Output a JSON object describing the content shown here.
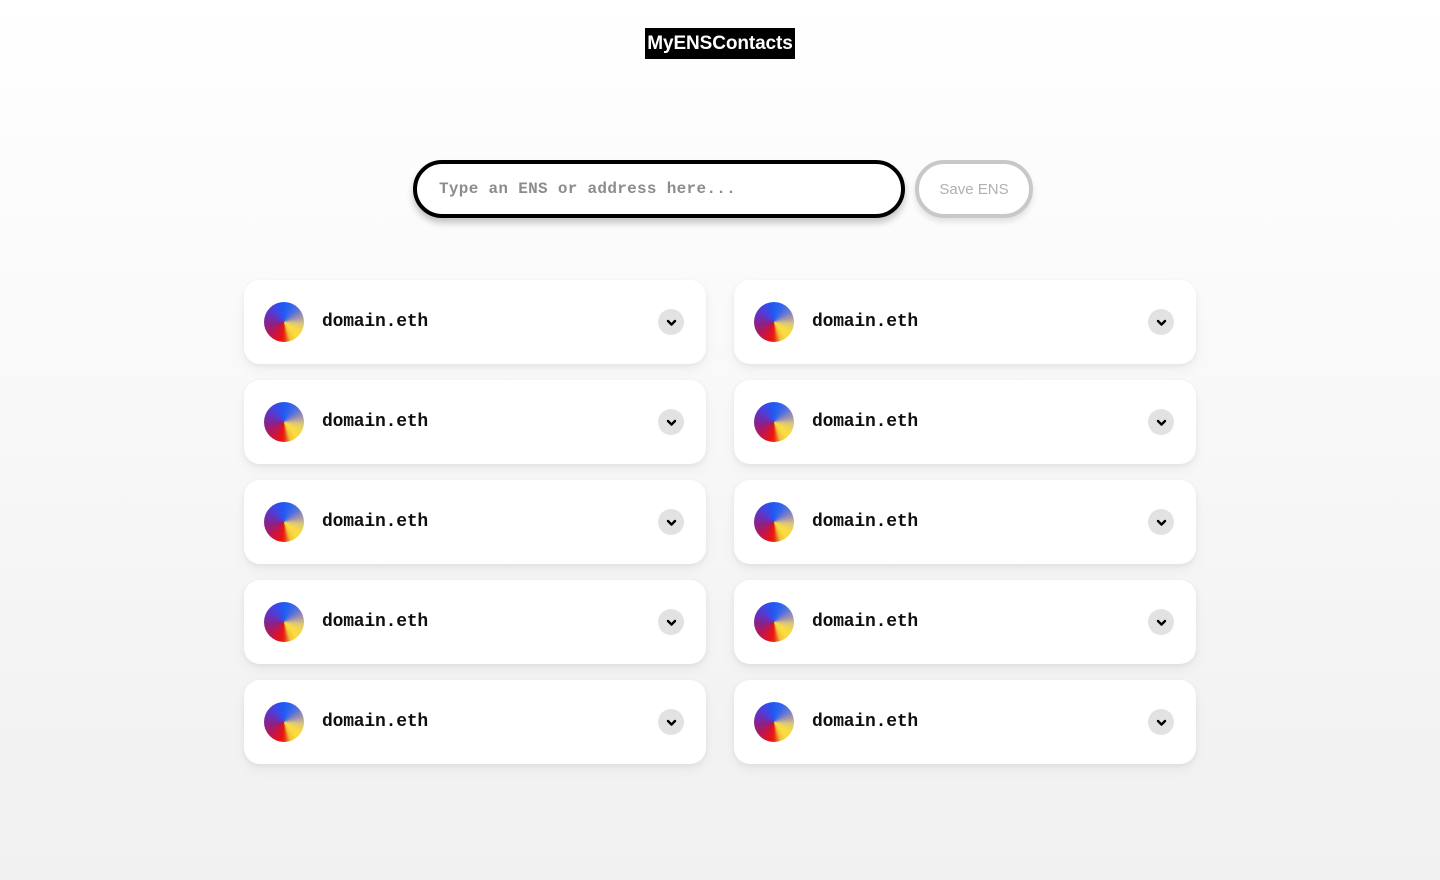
{
  "app": {
    "title": "MyENSContacts"
  },
  "search": {
    "placeholder": "Type an ENS or address here...",
    "value": "",
    "save_label": "Save ENS"
  },
  "contacts": {
    "columns": 2,
    "items": [
      {
        "name": "domain.eth",
        "avatar": "ens-gradient-avatar",
        "expand_icon": "chevron-down-icon"
      },
      {
        "name": "domain.eth",
        "avatar": "ens-gradient-avatar",
        "expand_icon": "chevron-down-icon"
      },
      {
        "name": "domain.eth",
        "avatar": "ens-gradient-avatar",
        "expand_icon": "chevron-down-icon"
      },
      {
        "name": "domain.eth",
        "avatar": "ens-gradient-avatar",
        "expand_icon": "chevron-down-icon"
      },
      {
        "name": "domain.eth",
        "avatar": "ens-gradient-avatar",
        "expand_icon": "chevron-down-icon"
      },
      {
        "name": "domain.eth",
        "avatar": "ens-gradient-avatar",
        "expand_icon": "chevron-down-icon"
      },
      {
        "name": "domain.eth",
        "avatar": "ens-gradient-avatar",
        "expand_icon": "chevron-down-icon"
      },
      {
        "name": "domain.eth",
        "avatar": "ens-gradient-avatar",
        "expand_icon": "chevron-down-icon"
      },
      {
        "name": "domain.eth",
        "avatar": "ens-gradient-avatar",
        "expand_icon": "chevron-down-icon"
      },
      {
        "name": "domain.eth",
        "avatar": "ens-gradient-avatar",
        "expand_icon": "chevron-down-icon"
      }
    ]
  },
  "colors": {
    "title_background": "#000000",
    "title_text": "#ffffff",
    "input_border": "#000000",
    "save_button_border": "#c8c8c8",
    "save_button_text": "#b0b0b0",
    "card_background": "#ffffff",
    "expand_button_background": "#e2e2e2",
    "page_background_top": "#ffffff",
    "page_background_bottom": "#f1f1f1"
  }
}
